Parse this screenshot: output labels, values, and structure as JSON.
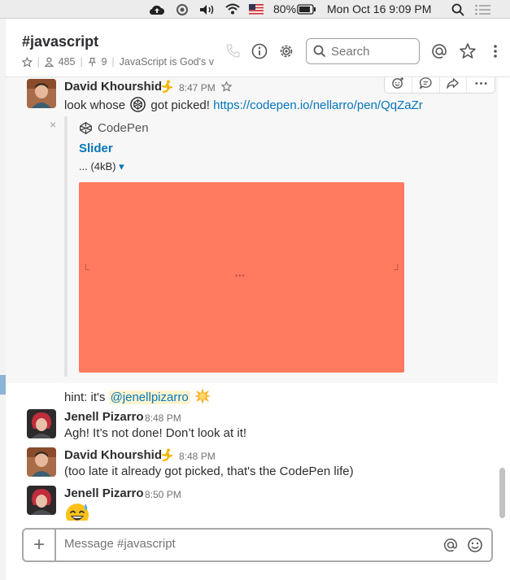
{
  "menubar": {
    "battery": "80%",
    "datetime": "Mon Oct 16  9:09 PM"
  },
  "header": {
    "channel_name": "#javascript",
    "members": "485",
    "pinned": "9",
    "topic": "JavaScript is God's v",
    "search_placeholder": "Search"
  },
  "messages": [
    {
      "author": "David Khourshid",
      "time": "8:47 PM",
      "text_before": "look whose",
      "text_after": "got picked!",
      "link": "https://codepen.io/nellarro/pen/QqZaZr"
    },
    {
      "hint_prefix": "hint: it's",
      "mention": "@jenellpizarro"
    },
    {
      "author": "Jenell Pizarro",
      "time": "8:48 PM",
      "text": "Agh! It’s not done! Don’t look at it!"
    },
    {
      "author": "David Khourshid",
      "time": "8:48 PM",
      "text": "(too late it already got picked, that's the CodePen life)"
    },
    {
      "author": "Jenell Pizarro",
      "time": "8:50 PM",
      "text": ""
    }
  ],
  "attachment": {
    "close": "×",
    "service": "CodePen",
    "title": "Slider",
    "size": "... (4kB)",
    "size_arrow": "▾",
    "image_dots": "•••",
    "color": "#ff7a5f"
  },
  "composer": {
    "plus": "+",
    "placeholder": "Message #javascript"
  },
  "colors": {
    "link": "#0576b9",
    "mention_bg": "#fff4cf"
  }
}
